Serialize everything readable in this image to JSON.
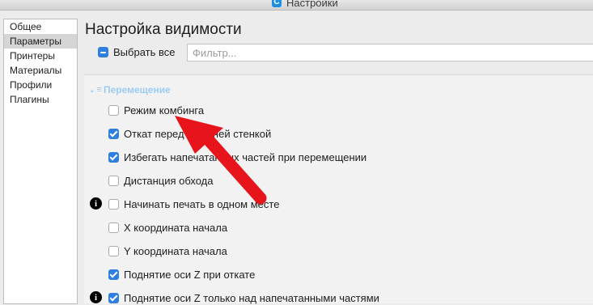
{
  "window": {
    "title": "Настройки"
  },
  "sidebar": {
    "items": [
      {
        "label": "Общее"
      },
      {
        "label": "Параметры"
      },
      {
        "label": "Принтеры"
      },
      {
        "label": "Материалы"
      },
      {
        "label": "Профили"
      },
      {
        "label": "Плагины"
      }
    ],
    "selected": "Параметры"
  },
  "main": {
    "title": "Настройка видимости",
    "select_all_label": "Выбрать все",
    "filter_placeholder": "Фильтр...",
    "category": {
      "label": "Перемещение",
      "icon": "travel-icon"
    },
    "settings": [
      {
        "label": "Режим комбинга",
        "checked": false
      },
      {
        "label": "Откат перед внешней стенкой",
        "checked": true
      },
      {
        "label": "Избегать напечатанных частей при перемещении",
        "checked": true
      },
      {
        "label": "Дистанция обхода",
        "checked": false
      },
      {
        "label": "Начинать печать в одном месте",
        "checked": false,
        "info": true
      },
      {
        "label": "X координата начала",
        "checked": false
      },
      {
        "label": "Y координата начала",
        "checked": false
      },
      {
        "label": "Поднятие оси Z при откате",
        "checked": true
      },
      {
        "label": "Поднятие оси Z только над напечатанными частями",
        "checked": true,
        "info": true
      }
    ]
  },
  "colors": {
    "accent": "#2f7fe0",
    "category": "#9ccbf3",
    "annotation_arrow": "#e8141b"
  }
}
